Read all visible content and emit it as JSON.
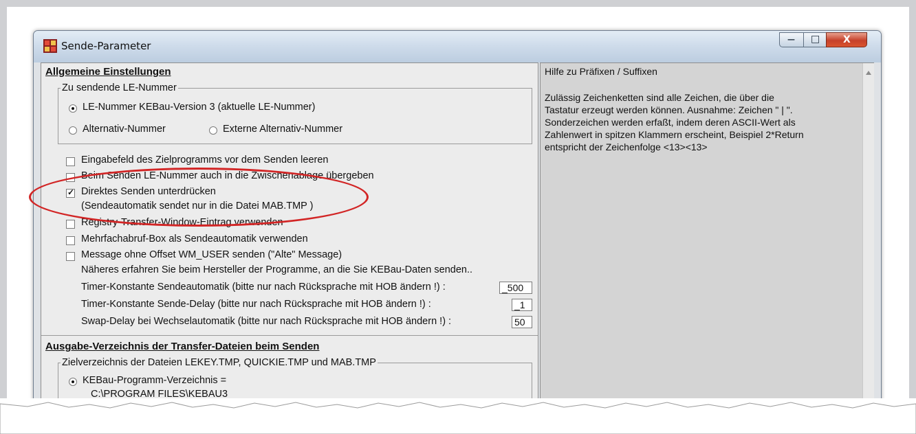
{
  "window": {
    "title": "Sende-Parameter",
    "buttons": {
      "minimize": "—",
      "maximize": "□",
      "close": "X"
    }
  },
  "general": {
    "header": "Allgemeine Einstellungen",
    "le_group": {
      "legend": "Zu sendende LE-Nummer",
      "opt1": "LE-Nummer KEBau-Version 3 (aktuelle LE-Nummer)",
      "opt2": "Alternativ-Nummer",
      "opt3": "Externe Alternativ-Nummer"
    },
    "checkboxes": [
      {
        "label": "Eingabefeld des Zielprogramms vor dem Senden leeren",
        "checked": false
      },
      {
        "label": "Beim Senden LE-Nummer auch in die Zwischenablage übergeben",
        "checked": false
      },
      {
        "label": "Direktes Senden unterdrücken",
        "checked": true
      },
      {
        "label": "Registry-Transfer-Window-Eintrag verwenden",
        "checked": false
      },
      {
        "label": "Mehrfachabruf-Box als Sendeautomatik verwenden",
        "checked": false
      },
      {
        "label": "Message ohne Offset WM_USER senden (\"Alte\" Message)",
        "checked": false
      }
    ],
    "direct_note": "(Sendeautomatik sendet nur in die Datei MAB.TMP )",
    "manufacturer_note": "Näheres erfahren Sie beim Hersteller der Programme, an die Sie KEBau-Daten senden..",
    "timers": [
      {
        "label": "Timer-Konstante Sendeautomatik (bitte nur nach Rücksprache mit HOB ändern !) :",
        "value": "_500"
      },
      {
        "label": "Timer-Konstante Sende-Delay (bitte nur nach Rücksprache mit HOB ändern !) :",
        "value": "_1"
      },
      {
        "label": "Swap-Delay bei Wechselautomatik (bitte nur nach Rücksprache mit HOB ändern !) :",
        "value": "50"
      }
    ]
  },
  "output": {
    "header": "Ausgabe-Verzeichnis der Transfer-Dateien beim Senden",
    "legend": "Zielverzeichnis der Dateien  LEKEY.TMP, QUICKIE.TMP und MAB.TMP",
    "opt1": "KEBau-Programm-Verzeichnis =",
    "path": "C:\\PROGRAM FILES\\KEBAU3"
  },
  "help": {
    "title": "Hilfe zu Präfixen / Suffixen",
    "lines": [
      "Zulässig Zeichenketten sind  alle Zeichen, die über die",
      "Tastatur erzeugt werden können.  Ausnahme: Zeichen \" | \".",
      "Sonderzeichen werden erfaßt, indem deren ASCII-Wert als",
      "Zahlenwert in spitzen Klammern erscheint, Beispiel 2*Return",
      "entspricht der Zeichenfolge  <13><13>"
    ]
  },
  "colors": {
    "annotation": "#d22525",
    "titlebar": "#cfdceb",
    "panel": "#ececec"
  }
}
